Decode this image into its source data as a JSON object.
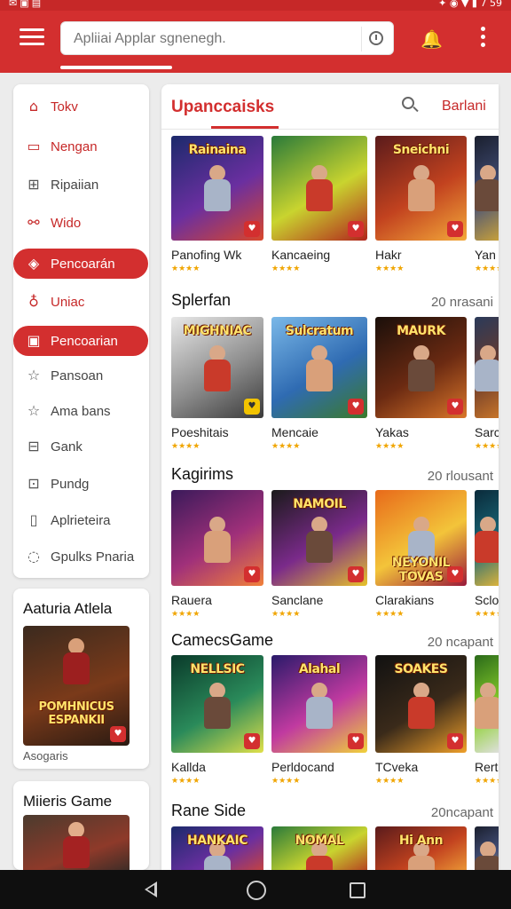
{
  "status_bar": {
    "time": "7 59"
  },
  "search": {
    "placeholder": "Apliiai Applar sgnenegh."
  },
  "sidebar": {
    "items": [
      {
        "label": "Tokv",
        "icon": "home-icon"
      },
      {
        "label": "Nengan",
        "icon": "tv-icon"
      },
      {
        "label": "Ripaiian",
        "icon": "gift-icon"
      },
      {
        "label": "Wido",
        "icon": "shuffle-icon"
      },
      {
        "label": "Pencoarán",
        "icon": "tag-icon"
      },
      {
        "label": "Uniac",
        "icon": "user-icon"
      },
      {
        "label": "Pencoarian",
        "icon": "calendar-icon"
      },
      {
        "label": "Pansoan",
        "icon": "star-icon"
      },
      {
        "label": "Ama bans",
        "icon": "star-outline-icon"
      },
      {
        "label": "Gank",
        "icon": "grid-icon"
      },
      {
        "label": "Pundg",
        "icon": "card-icon"
      },
      {
        "label": "Aplrieteira",
        "icon": "file-icon"
      },
      {
        "label": "Gpulks Pnaria",
        "icon": "chat-icon"
      }
    ]
  },
  "promos": [
    {
      "title": "Aaturia Atlela",
      "art_text": "POMHNICUS ESPANKII",
      "caption": "Asogaris"
    },
    {
      "title": "Miieris Game"
    }
  ],
  "main": {
    "title": "Upanccaisks",
    "link": "Barlani",
    "sections": [
      {
        "title": "",
        "more": "",
        "tiles": [
          {
            "name": "Panofing Wk",
            "art": "Rainaina",
            "stars": "★★★★"
          },
          {
            "name": "Kancaeing",
            "art": "",
            "stars": "★★★★"
          },
          {
            "name": "Hakr",
            "art": "Sneichni",
            "stars": "★★★★"
          },
          {
            "name": "Yan",
            "art": "",
            "stars": "★★★★"
          }
        ]
      },
      {
        "title": "Splerfan",
        "more": "20 nrasani",
        "tiles": [
          {
            "name": "Poeshitais",
            "art": "MIGHNIAC",
            "stars": "★★★★"
          },
          {
            "name": "Mencaie",
            "art": "Sulcratum",
            "stars": "★★★★"
          },
          {
            "name": "Yakas",
            "art": "MAURK",
            "stars": "★★★★"
          },
          {
            "name": "Sarc",
            "art": "",
            "stars": "★★★★"
          }
        ]
      },
      {
        "title": "Kagirims",
        "more": "20 rlousant",
        "tiles": [
          {
            "name": "Rauera",
            "art": "",
            "stars": "★★★★"
          },
          {
            "name": "Sanclane",
            "art": "NAMOIL",
            "stars": "★★★★"
          },
          {
            "name": "Clarakians",
            "art": "NEYONIL TOVAS",
            "stars": "★★★★"
          },
          {
            "name": "Sclo",
            "art": "",
            "stars": "★★★★"
          }
        ]
      },
      {
        "title": "CamecsGame",
        "more": "20 ncapant",
        "tiles": [
          {
            "name": "Kallda",
            "art": "NELLSIC",
            "stars": "★★★★"
          },
          {
            "name": "Perldocand",
            "art": "Alahal",
            "stars": "★★★★"
          },
          {
            "name": "TCveka",
            "art": "SOAKES",
            "stars": "★★★★"
          },
          {
            "name": "Rert",
            "art": "",
            "stars": "★★★★"
          }
        ]
      },
      {
        "title": "Rane Side",
        "more": "20ncapant",
        "tiles": [
          {
            "name": "",
            "art": "HANKAIC",
            "stars": ""
          },
          {
            "name": "",
            "art": "NOMAL",
            "stars": ""
          },
          {
            "name": "",
            "art": "Hi Ann",
            "stars": ""
          },
          {
            "name": "",
            "art": "",
            "stars": ""
          }
        ]
      }
    ]
  },
  "colors": {
    "accent": "#d32f2f",
    "stars": "#f0a500",
    "navbar": "#0f0f0f"
  }
}
